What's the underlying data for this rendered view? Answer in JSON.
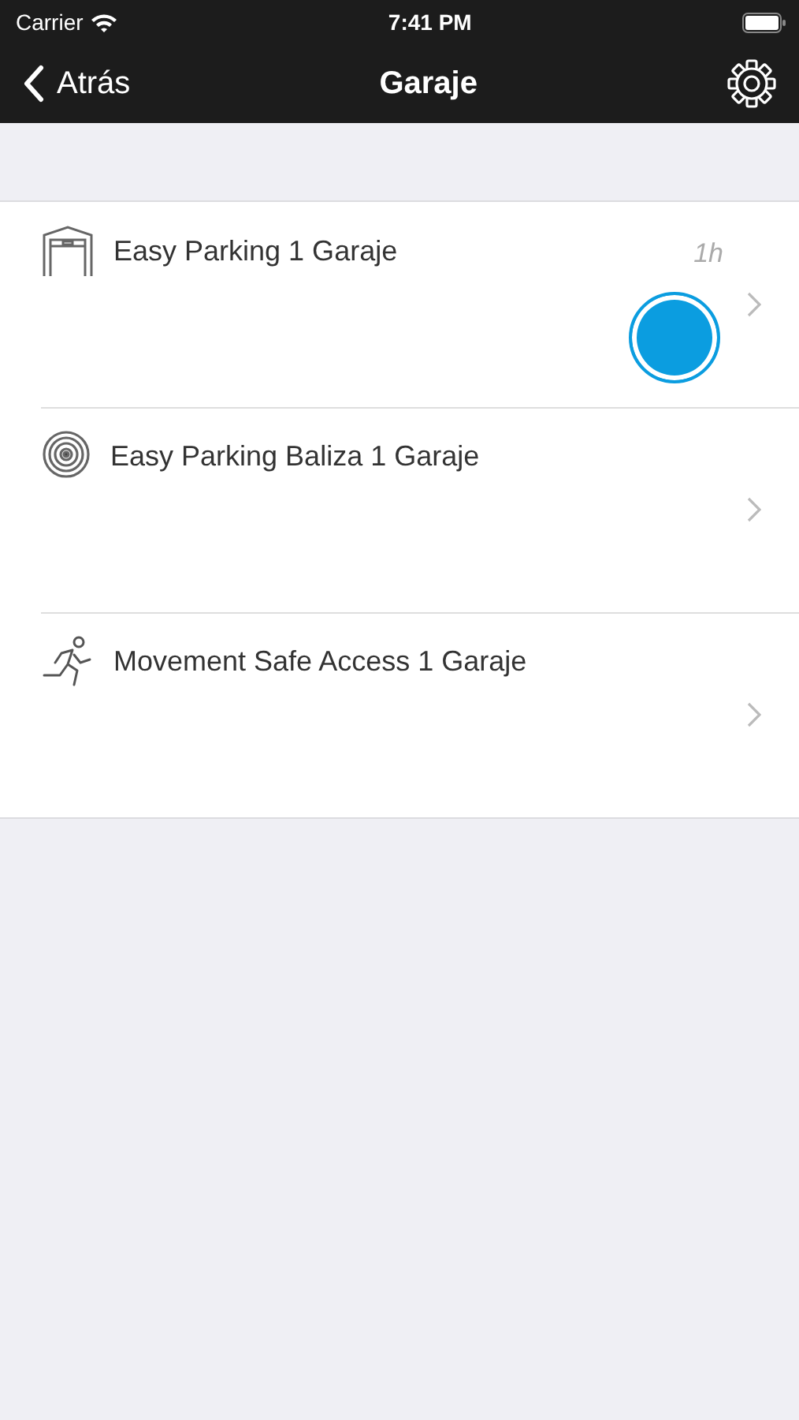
{
  "status_bar": {
    "carrier": "Carrier",
    "time": "7:41 PM"
  },
  "nav": {
    "back": "Atrás",
    "title": "Garaje"
  },
  "devices": [
    {
      "kind": "garage",
      "name": "Easy Parking 1 Garaje",
      "time": "1h",
      "color": "#0b9de0"
    },
    {
      "kind": "beacon",
      "name": "Easy Parking Baliza 1 Garaje"
    },
    {
      "kind": "motion",
      "name": "Movement Safe Access 1 Garaje"
    }
  ]
}
